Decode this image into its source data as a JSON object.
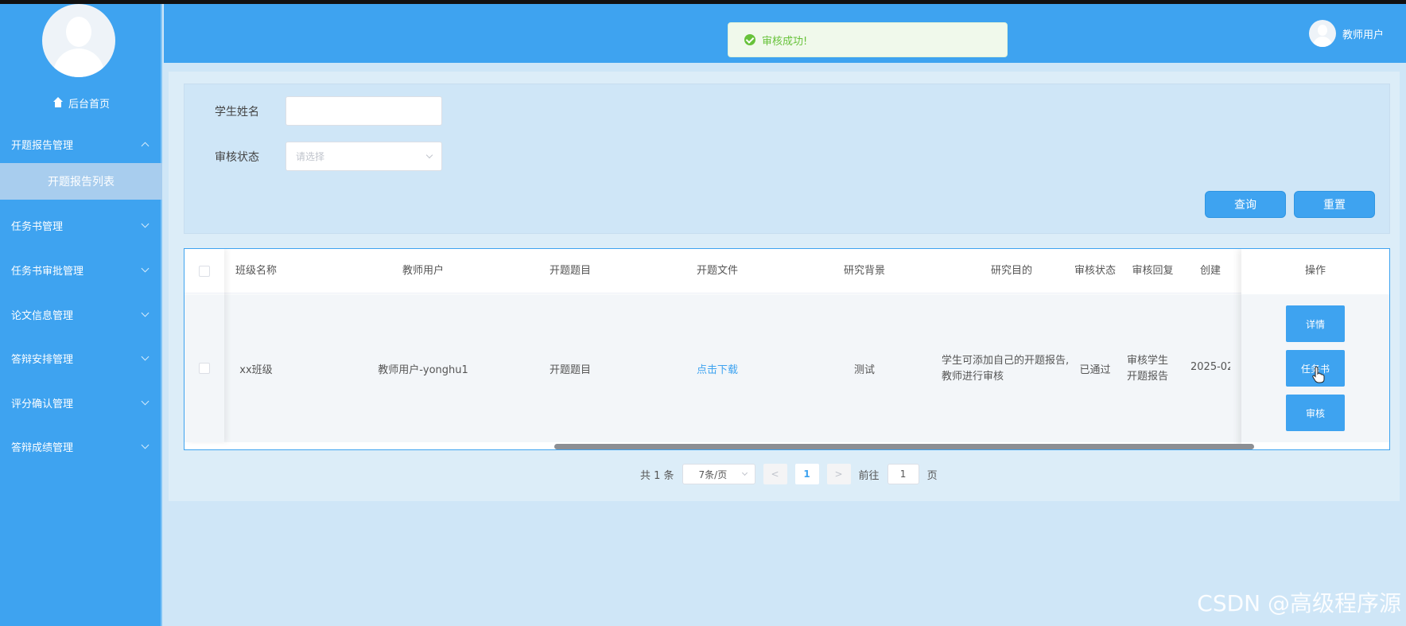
{
  "header": {
    "toast": "审核成功!",
    "user_name": "教师用户"
  },
  "sidebar": {
    "home": "后台首页",
    "items": [
      {
        "label": "开题报告管理"
      },
      {
        "label": "任务书管理"
      },
      {
        "label": "任务书审批管理"
      },
      {
        "label": "论文信息管理"
      },
      {
        "label": "答辩安排管理"
      },
      {
        "label": "评分确认管理"
      },
      {
        "label": "答辩成绩管理"
      }
    ],
    "active_sub": "开题报告列表"
  },
  "search": {
    "student_name_label": "学生姓名",
    "status_label": "审核状态",
    "status_placeholder": "请选择",
    "query_button": "查询",
    "reset_button": "重置"
  },
  "table": {
    "columns": [
      "班级名称",
      "教师用户",
      "开题题目",
      "开题文件",
      "研究背景",
      "研究目的",
      "审核状态",
      "审核回复",
      "创建",
      "操作"
    ],
    "rows": [
      {
        "class_name": "xx班级",
        "teacher": "教师用户-yonghu1",
        "topic": "开题题目",
        "file": "点击下载",
        "background": "测试",
        "purpose_line1": "学生可添加自己的开题报告,",
        "purpose_line2": "教师进行审核",
        "status": "已通过",
        "reply_line1": "审核学生",
        "reply_line2": "开题报告",
        "created": "2025-02",
        "ops": [
          "详情",
          "任务书",
          "审核"
        ]
      }
    ]
  },
  "pagination": {
    "total": "共 1 条",
    "page_size": "7条/页",
    "prev": "<",
    "current": "1",
    "next": ">",
    "goto_label": "前往",
    "goto_value": "1",
    "page_unit": "页"
  },
  "watermark": "CSDN @高级程序源"
}
